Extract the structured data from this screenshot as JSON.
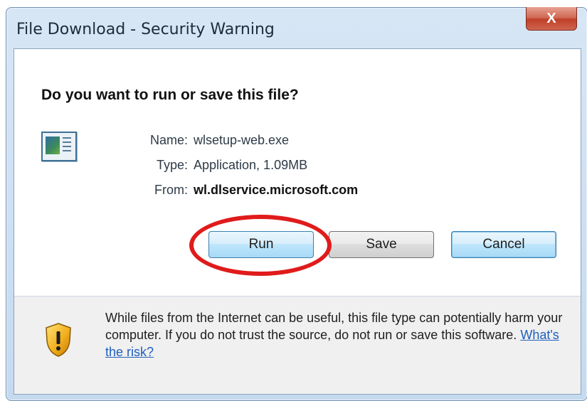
{
  "window": {
    "title": "File Download - Security Warning",
    "close_label": "X"
  },
  "dialog": {
    "question": "Do you want to run or save this file?",
    "file": {
      "icon": "application-file-icon",
      "name_label": "Name:",
      "name_value": "wlsetup-web.exe",
      "type_label": "Type:",
      "type_value": "Application, 1.09MB",
      "from_label": "From:",
      "from_value": "wl.dlservice.microsoft.com"
    },
    "buttons": {
      "run": "Run",
      "save": "Save",
      "cancel": "Cancel"
    },
    "annotation_color": "#e01b1b"
  },
  "footer": {
    "icon": "security-shield-icon",
    "warning_text": "While files from the Internet can be useful, this file type can potentially harm your computer. If you do not trust the source, do not run or save this software.",
    "risk_link": "What's the risk?",
    "link_color": "#1f5fbf"
  }
}
